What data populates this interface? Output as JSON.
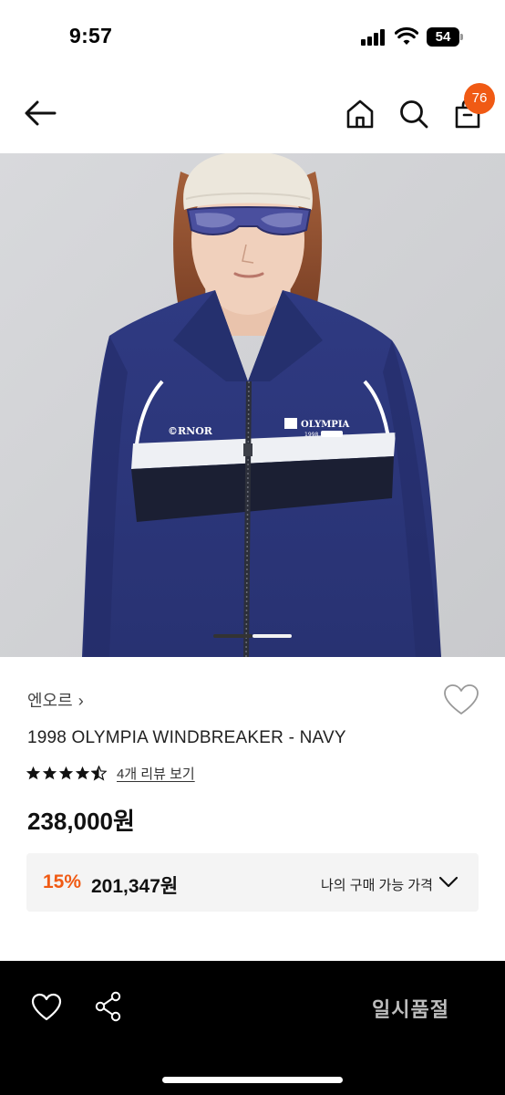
{
  "status_bar": {
    "time": "9:57",
    "battery": "54",
    "icons": [
      "signal-icon",
      "wifi-icon",
      "battery-icon"
    ]
  },
  "nav": {
    "back_icon": "arrow-left-icon",
    "home_icon": "home-icon",
    "search_icon": "search-icon",
    "cart_icon": "shopping-bag-icon",
    "cart_count": "76",
    "badge_color": "#f05a14"
  },
  "gallery": {
    "image_alt": "1998 OLYMPIA WINDBREAKER - NAVY",
    "logo_left": "©RNOR",
    "logo_right": "OLYMPIA",
    "logo_right_sub": "1998",
    "current_slide": 1,
    "total_slides": 2
  },
  "product": {
    "brand": "엔오르",
    "brand_chevron": "›",
    "title": "1998 OLYMPIA WINDBREAKER - NAVY",
    "rating": 4.5,
    "review_link": "4개 리뷰 보기",
    "price": "238,000원",
    "wishlist_icon": "heart-icon"
  },
  "benefit": {
    "discount_rate": "15%",
    "discount_price": "201,347원",
    "label": "나의 구매 가능 가격",
    "chevron_icon": "chevron-down-icon",
    "accent_color": "#f05a14"
  },
  "bottom_bar": {
    "wish_icon": "heart-icon",
    "share_icon": "share-icon",
    "status_label": "일시품절"
  }
}
